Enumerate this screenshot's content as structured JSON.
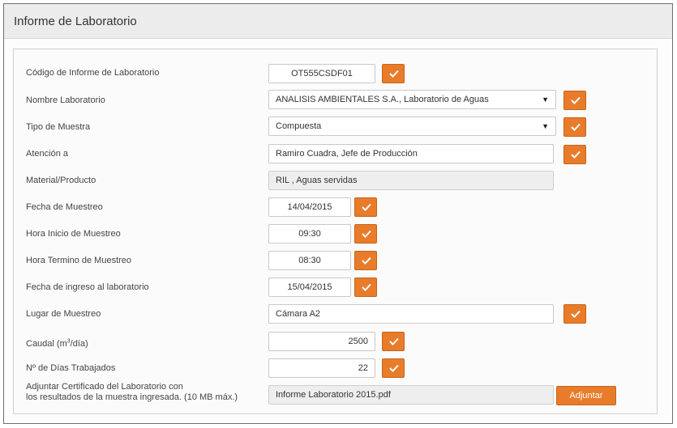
{
  "window": {
    "title": "Informe de Laboratorio"
  },
  "form": {
    "codigo": {
      "label": "Código de Informe de Laboratorio",
      "value": "OT555CSDF01"
    },
    "nombre_lab": {
      "label": "Nombre Laboratorio",
      "value": "ANALISIS AMBIENTALES S.A., Laboratorio de Aguas"
    },
    "tipo_muestra": {
      "label": "Tipo de Muestra",
      "value": "Compuesta"
    },
    "atencion": {
      "label": "Atención a",
      "value": "Ramiro Cuadra, Jefe de Producción"
    },
    "material": {
      "label": "Material/Producto",
      "value": "RIL , Aguas servidas"
    },
    "fecha_muestreo": {
      "label": "Fecha de Muestreo",
      "value": "14/04/2015"
    },
    "hora_inicio": {
      "label": "Hora Inicio de Muestreo",
      "value": "09:30"
    },
    "hora_termino": {
      "label": "Hora Termino de Muestreo",
      "value": "08:30"
    },
    "fecha_ingreso": {
      "label": "Fecha de ingreso al laboratorio",
      "value": "15/04/2015"
    },
    "lugar": {
      "label": "Lugar de Muestreo",
      "value": "Cámara A2"
    },
    "caudal": {
      "label_prefix": "Caudal (m",
      "label_sup": "3",
      "label_suffix": "/día)",
      "value": "2500"
    },
    "dias": {
      "label": "Nº de Días Trabajados",
      "value": "22"
    },
    "adjuntar": {
      "label_line1": "Adjuntar Certificado del Laboratorio con",
      "label_line2": "los resultados de la muestra ingresada. (10 MB máx.)",
      "value": "Informe Laboratorio 2015.pdf",
      "button_label": "Adjuntar"
    }
  },
  "colors": {
    "accent": "#e87c2a",
    "accent_border": "#c86419"
  },
  "icons": {
    "confirm": "check-icon",
    "dropdown": "caret-down-icon"
  }
}
